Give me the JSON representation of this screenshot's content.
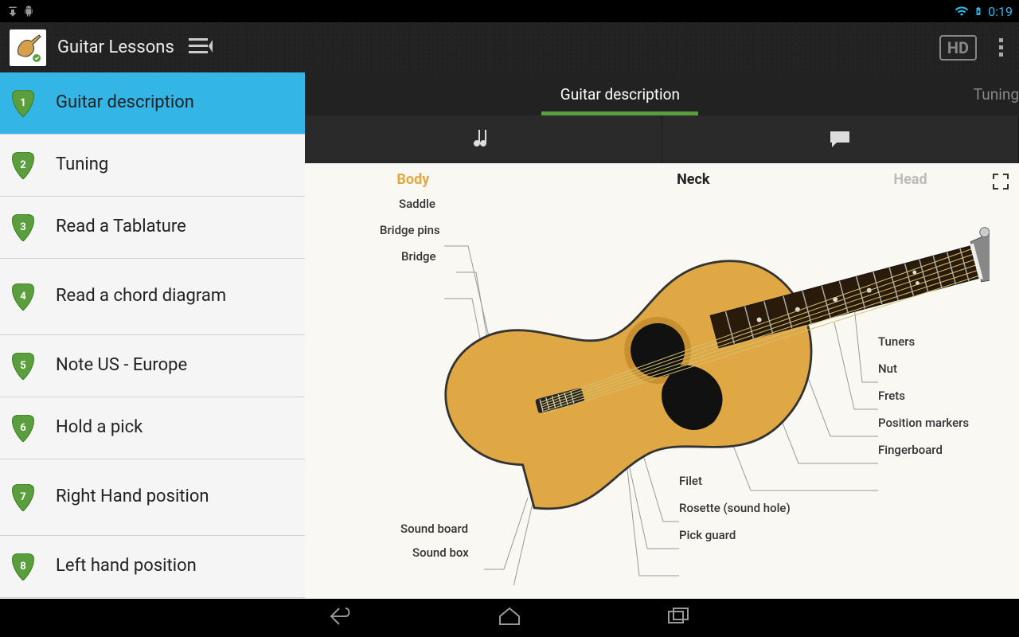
{
  "status": {
    "time": "0:19"
  },
  "actionbar": {
    "title": "Guitar Lessons",
    "hd": "HD"
  },
  "sidebar": {
    "items": [
      {
        "num": "1",
        "label": "Guitar description",
        "active": true
      },
      {
        "num": "2",
        "label": "Tuning"
      },
      {
        "num": "3",
        "label": "Read a Tablature"
      },
      {
        "num": "4",
        "label": "Read a chord diagram",
        "tall": true
      },
      {
        "num": "5",
        "label": "Note US - Europe"
      },
      {
        "num": "6",
        "label": "Hold a pick"
      },
      {
        "num": "7",
        "label": "Right Hand position",
        "tall": true
      },
      {
        "num": "8",
        "label": "Left hand position"
      }
    ]
  },
  "tabs": {
    "active": "Guitar description",
    "next": "Tuning"
  },
  "diagram": {
    "sections": {
      "body": "Body",
      "neck": "Neck",
      "head": "Head"
    },
    "labels_left": [
      "Saddle",
      "Bridge pins",
      "Bridge",
      "Sound board",
      "Sound box"
    ],
    "labels_right": [
      "Tuners",
      "Nut",
      "Frets",
      "Position markers",
      "Fingerboard"
    ],
    "labels_bottom": [
      "Filet",
      "Rosette (sound hole)",
      "Pick guard"
    ]
  }
}
